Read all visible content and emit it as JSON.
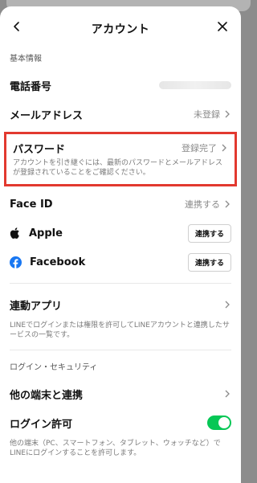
{
  "nav": {
    "title": "アカウント"
  },
  "sections": {
    "basic_label": "基本情報",
    "security_label": "ログイン・セキュリティ"
  },
  "rows": {
    "phone": {
      "label": "電話番号",
      "value_hidden": true
    },
    "email": {
      "label": "メールアドレス",
      "value": "未登録"
    },
    "password": {
      "label": "パスワード",
      "value": "登録完了",
      "helper": "アカウントを引き継ぐには、最新のパスワードとメールアドレスが登録されていることをご確認ください。"
    },
    "faceid": {
      "label": "Face ID",
      "value": "連携する"
    },
    "apple": {
      "label": "Apple",
      "button": "連携する"
    },
    "facebook": {
      "label": "Facebook",
      "button": "連携する"
    },
    "linked_apps": {
      "label": "連動アプリ",
      "helper": "LINEでログインまたは権限を許可してLINEアカウントと連携したサービスの一覧です。"
    },
    "other_devices": {
      "label": "他の端末と連携"
    },
    "login_permission": {
      "label": "ログイン許可",
      "enabled": true,
      "helper": "他の端末（PC、スマートフォン、タブレット、ウォッチなど）でLINEにログインすることを許可します。"
    }
  },
  "colors": {
    "highlight": "#e2392f",
    "toggle_on": "#06c755",
    "facebook_blue": "#1877f2"
  }
}
